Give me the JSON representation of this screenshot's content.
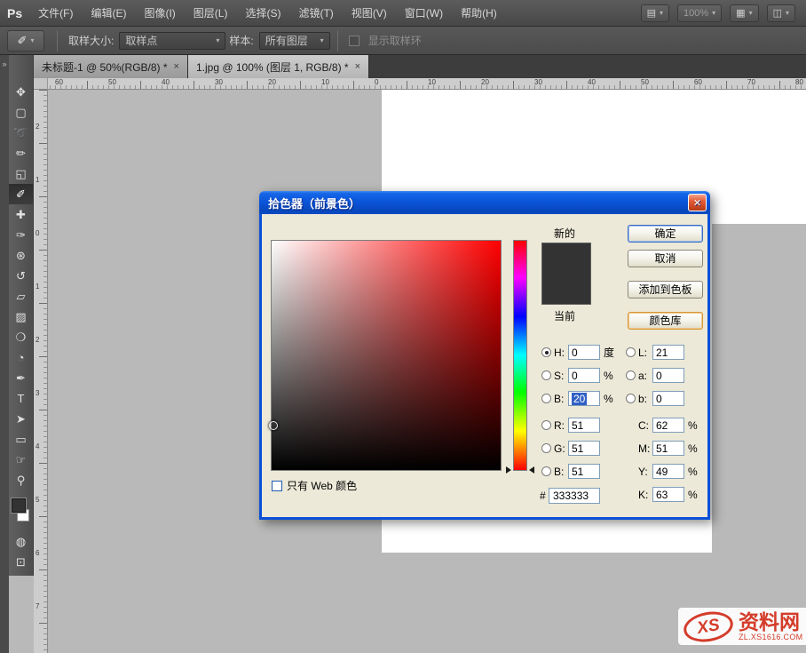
{
  "app": {
    "logo": "Ps"
  },
  "menubar": {
    "items": [
      "文件(F)",
      "编辑(E)",
      "图像(I)",
      "图层(L)",
      "选择(S)",
      "滤镜(T)",
      "视图(V)",
      "窗口(W)",
      "帮助(H)"
    ],
    "zoom": "100%"
  },
  "optionsbar": {
    "sample_size_label": "取样大小:",
    "sample_size_value": "取样点",
    "sample_label": "样本:",
    "sample_value": "所有图层",
    "show_sample_ring": "显示取样环"
  },
  "tabs": {
    "tab1": "未标题-1 @ 50%(RGB/8) *",
    "tab2": "1.jpg @ 100% (图层 1, RGB/8) *"
  },
  "rulers": {
    "horizontal": [
      "60",
      "50",
      "40",
      "30",
      "20",
      "10",
      "0",
      "10",
      "20",
      "30",
      "40",
      "50",
      "60",
      "70",
      "80"
    ],
    "vertical": [
      "2",
      "1",
      "0",
      "1",
      "2",
      "3",
      "4",
      "5",
      "6",
      "7"
    ]
  },
  "tools": [
    {
      "name": "move",
      "glyph": "✥"
    },
    {
      "name": "marquee",
      "glyph": "▢"
    },
    {
      "name": "lasso",
      "glyph": "➰"
    },
    {
      "name": "quick-selection",
      "glyph": "✏"
    },
    {
      "name": "crop",
      "glyph": "◱"
    },
    {
      "name": "eyedropper",
      "glyph": "✐"
    },
    {
      "name": "healing-brush",
      "glyph": "✚"
    },
    {
      "name": "brush",
      "glyph": "✑"
    },
    {
      "name": "clone-stamp",
      "glyph": "⊛"
    },
    {
      "name": "history-brush",
      "glyph": "↺"
    },
    {
      "name": "eraser",
      "glyph": "▱"
    },
    {
      "name": "gradient",
      "glyph": "▨"
    },
    {
      "name": "blur",
      "glyph": "❍"
    },
    {
      "name": "dodge",
      "glyph": "◔"
    },
    {
      "name": "pen",
      "glyph": "✒"
    },
    {
      "name": "type",
      "glyph": "T"
    },
    {
      "name": "path-selection",
      "glyph": "➤"
    },
    {
      "name": "rectangle",
      "glyph": "▭"
    },
    {
      "name": "hand",
      "glyph": "☞"
    },
    {
      "name": "zoom",
      "glyph": "⚲"
    },
    {
      "name": "quick-mask",
      "glyph": "◍"
    },
    {
      "name": "screen-mode",
      "glyph": "⊡"
    }
  ],
  "colors": {
    "foreground": "#333333",
    "background": "#ffffff"
  },
  "picker": {
    "title": "拾色器（前景色）",
    "new_label": "新的",
    "current_label": "当前",
    "buttons": {
      "ok": "确定",
      "cancel": "取消",
      "add": "添加到色板",
      "lib": "颜色库"
    },
    "fields": {
      "hue": {
        "label": "H:",
        "value": "0",
        "unit": "度"
      },
      "sat": {
        "label": "S:",
        "value": "0",
        "unit": "%"
      },
      "bri": {
        "label": "B:",
        "value": "20",
        "unit": "%"
      },
      "L": {
        "label": "L:",
        "value": "21"
      },
      "a": {
        "label": "a:",
        "value": "0"
      },
      "b": {
        "label": "b:",
        "value": "0"
      },
      "R": {
        "label": "R:",
        "value": "51"
      },
      "G": {
        "label": "G:",
        "value": "51"
      },
      "B": {
        "label": "B:",
        "value": "51"
      },
      "C": {
        "label": "C:",
        "value": "62",
        "unit": "%"
      },
      "M": {
        "label": "M:",
        "value": "51",
        "unit": "%"
      },
      "Y": {
        "label": "Y:",
        "value": "49",
        "unit": "%"
      },
      "K": {
        "label": "K:",
        "value": "63",
        "unit": "%"
      }
    },
    "hex_prefix": "#",
    "hex": "333333",
    "web_only": "只有 Web 颜色",
    "new_color": "#333333",
    "current_color": "#333333"
  },
  "watermark": {
    "logo": "XS",
    "name": "资料网",
    "url": "ZL.XS1616.COM"
  },
  "icons": {
    "close": "✕",
    "tab_close": "×",
    "dropdown": "▾",
    "collapse": "»",
    "bridge": "▤",
    "arrange": "▦",
    "screen": "◫"
  }
}
